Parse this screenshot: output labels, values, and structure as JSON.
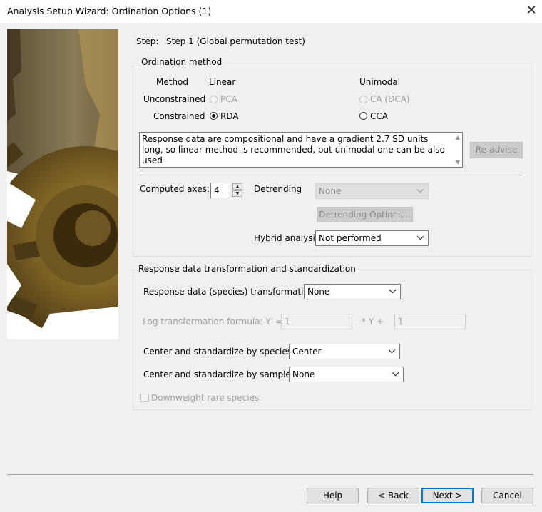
{
  "window": {
    "title": "Analysis Setup Wizard: Ordination Options (1)"
  },
  "step": {
    "label": "Step:",
    "value": "Step 1 (Global permutation test)"
  },
  "ordination": {
    "legend": "Ordination method",
    "col_method": "Method",
    "col_linear": "Linear",
    "col_unimodal": "Unimodal",
    "row_unconstrained": "Unconstrained",
    "row_constrained": "Constrained",
    "pca": "PCA",
    "ca": "CA (DCA)",
    "rda": "RDA",
    "cca": "CCA",
    "selected": "RDA",
    "advice": "Response data are compositional and have a gradient 2.7 SD units long, so linear method is recommended, but unimodal one can be also used",
    "readvise": "Re-advise",
    "computed_axes_label": "Computed axes:",
    "computed_axes_value": "4",
    "detrending_label": "Detrending",
    "detrending_value": "None",
    "detrending_options": "Detrending Options...",
    "hybrid_label": "Hybrid analysis",
    "hybrid_value": "Not performed"
  },
  "transform": {
    "legend": "Response data transformation and standardization",
    "species_transform_label": "Response data (species) transformation",
    "species_transform_value": "None",
    "log_formula_label": "Log transformation formula: Y' =",
    "log_a": "1",
    "times_y_plus": "* Y +",
    "log_b": "1",
    "center_species_label": "Center and standardize by species",
    "center_species_value": "Center",
    "center_samples_label": "Center and standardize by samples",
    "center_samples_value": "None",
    "downweight_label": "Downweight rare species"
  },
  "buttons": {
    "help": "Help",
    "back": "< Back",
    "next": "Next >",
    "cancel": "Cancel"
  },
  "icons": {
    "close": "close-icon",
    "chevron": "chevron-down-icon"
  },
  "colors": {
    "default_button_border": "#0078d7",
    "window_bg": "#f0f0f0"
  }
}
